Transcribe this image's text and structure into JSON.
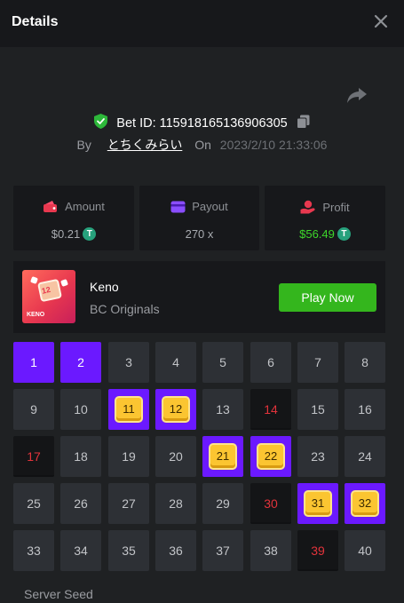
{
  "header": {
    "title": "Details"
  },
  "bet": {
    "id_label": "Bet ID: 115918165136906305",
    "by_label": "By",
    "username": "とちくみらい",
    "on_label": "On",
    "date": "2023/2/10 21:33:06"
  },
  "stats": {
    "amount": {
      "label": "Amount",
      "value": "$0.21",
      "coin": "T"
    },
    "payout": {
      "label": "Payout",
      "value": "270 x"
    },
    "profit": {
      "label": "Profit",
      "value": "$56.49",
      "coin": "T"
    }
  },
  "game": {
    "name": "Keno",
    "provider": "BC Originals",
    "play_label": "Play Now",
    "thumb_number": "12",
    "thumb_text": "KENO"
  },
  "grid": {
    "tiles": [
      {
        "n": "1",
        "state": "selected"
      },
      {
        "n": "2",
        "state": "selected"
      },
      {
        "n": "3",
        "state": "normal"
      },
      {
        "n": "4",
        "state": "normal"
      },
      {
        "n": "5",
        "state": "normal"
      },
      {
        "n": "6",
        "state": "normal"
      },
      {
        "n": "7",
        "state": "normal"
      },
      {
        "n": "8",
        "state": "normal"
      },
      {
        "n": "9",
        "state": "normal"
      },
      {
        "n": "10",
        "state": "normal"
      },
      {
        "n": "11",
        "state": "hit"
      },
      {
        "n": "12",
        "state": "hit"
      },
      {
        "n": "13",
        "state": "normal"
      },
      {
        "n": "14",
        "state": "drawn"
      },
      {
        "n": "15",
        "state": "normal"
      },
      {
        "n": "16",
        "state": "normal"
      },
      {
        "n": "17",
        "state": "drawn"
      },
      {
        "n": "18",
        "state": "normal"
      },
      {
        "n": "19",
        "state": "normal"
      },
      {
        "n": "20",
        "state": "normal"
      },
      {
        "n": "21",
        "state": "hit"
      },
      {
        "n": "22",
        "state": "hit"
      },
      {
        "n": "23",
        "state": "normal"
      },
      {
        "n": "24",
        "state": "normal"
      },
      {
        "n": "25",
        "state": "normal"
      },
      {
        "n": "26",
        "state": "normal"
      },
      {
        "n": "27",
        "state": "normal"
      },
      {
        "n": "28",
        "state": "normal"
      },
      {
        "n": "29",
        "state": "normal"
      },
      {
        "n": "30",
        "state": "drawn"
      },
      {
        "n": "31",
        "state": "hit"
      },
      {
        "n": "32",
        "state": "hit"
      },
      {
        "n": "33",
        "state": "normal"
      },
      {
        "n": "34",
        "state": "normal"
      },
      {
        "n": "35",
        "state": "normal"
      },
      {
        "n": "36",
        "state": "normal"
      },
      {
        "n": "37",
        "state": "normal"
      },
      {
        "n": "38",
        "state": "normal"
      },
      {
        "n": "39",
        "state": "drawn"
      },
      {
        "n": "40",
        "state": "normal"
      }
    ]
  },
  "seed": {
    "label": "Server Seed"
  },
  "colors": {
    "accent_purple": "#6b19ff",
    "play_green": "#34b61d",
    "profit_green": "#3dd62a",
    "miss_red": "#e2333b",
    "gem_gold": "#fbc531"
  },
  "icons": {
    "close": "close-icon",
    "share": "share-icon",
    "verified": "shield-check-icon",
    "copy": "copy-icon",
    "amount": "wallet-icon",
    "payout": "card-icon",
    "profit": "profit-icon",
    "coin": "tether-coin-icon"
  }
}
